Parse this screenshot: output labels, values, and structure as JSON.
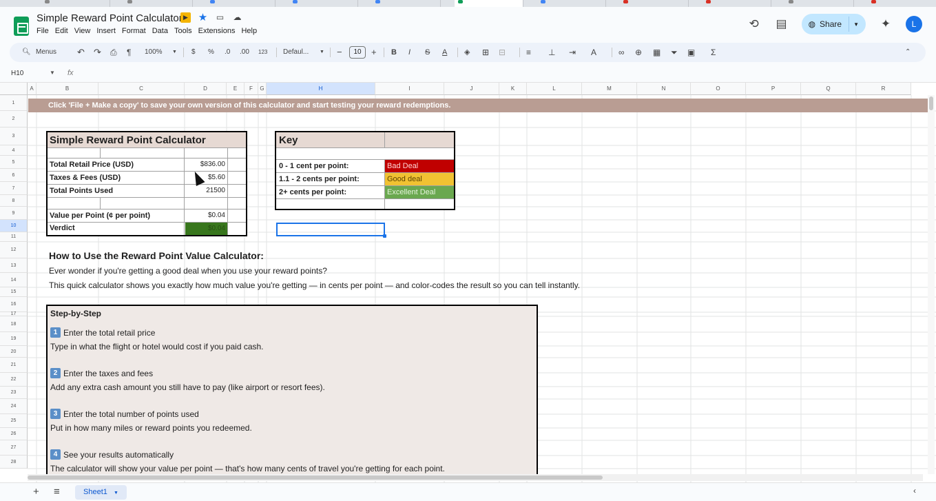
{
  "app": {
    "doc_title": "Simple Reward Point Calculator",
    "menu": [
      "File",
      "Edit",
      "View",
      "Insert",
      "Format",
      "Data",
      "Tools",
      "Extensions",
      "Help"
    ],
    "share_label": "Share",
    "avatar_initial": "L"
  },
  "toolbar": {
    "menus_label": "Menus",
    "zoom": "100%",
    "currency": "$",
    "percent": "%",
    "dec_decrease": ".0",
    "dec_increase": ".00",
    "number_format": "123",
    "font": "Defaul...",
    "font_size": "10",
    "minus": "−",
    "plus": "+"
  },
  "formula_bar": {
    "cell_ref": "H10",
    "fx": "fx"
  },
  "columns": [
    "A",
    "B",
    "C",
    "D",
    "E",
    "F",
    "G",
    "H",
    "I",
    "J",
    "K",
    "L",
    "M",
    "N",
    "O",
    "P",
    "Q",
    "R"
  ],
  "rows": [
    "1",
    "2",
    "3",
    "4",
    "5",
    "6",
    "7",
    "8",
    "9",
    "10",
    "11",
    "12",
    "13",
    "14",
    "15",
    "16",
    "17",
    "18",
    "19",
    "20",
    "21",
    "22",
    "23",
    "24",
    "25",
    "26",
    "27",
    "28"
  ],
  "banner": "Click 'File + Make a copy' to save your own version of this calculator and start testing your reward redemptions.",
  "calculator": {
    "title": "Simple Reward Point Calculator",
    "rows": [
      {
        "label": "Total Retail Price (USD)",
        "value": "$836.00"
      },
      {
        "label": "Taxes & Fees (USD)",
        "value": "$5.60"
      },
      {
        "label": "Total Points Used",
        "value": "21500"
      },
      {
        "label": "Value per Point (¢ per point)",
        "value": "$0.04"
      },
      {
        "label": "Verdict",
        "value": "$0.04"
      }
    ]
  },
  "key": {
    "title": "Key",
    "rows": [
      {
        "label": "0 - 1 cent per point:",
        "value": "Bad Deal",
        "color": "#c00000"
      },
      {
        "label": "1.1 - 2 cents per point:",
        "value": "Good deal",
        "color": "#f1c232"
      },
      {
        "label": "2+ cents per point:",
        "value": "Excellent Deal",
        "color": "#6aa84f"
      }
    ]
  },
  "howto": {
    "title": "How to Use the Reward Point Value Calculator:",
    "line1": "Ever wonder if you're getting a good deal when you use your reward points?",
    "line2": "This quick calculator shows you exactly how much value you're getting — in cents per point — and color-codes the result so you can tell instantly."
  },
  "steps": {
    "heading": "Step-by-Step",
    "items": [
      {
        "num": "1",
        "title": "Enter the total retail price",
        "desc": "Type in what the flight or hotel would cost if you paid cash."
      },
      {
        "num": "2",
        "title": "Enter the taxes and fees",
        "desc": "Add any extra cash amount you still have to pay (like airport or resort fees)."
      },
      {
        "num": "3",
        "title": "Enter the total number of points used",
        "desc": "Put in how many miles or reward points you redeemed."
      },
      {
        "num": "4",
        "title": "See your results automatically",
        "desc": "The calculator will show your value per point — that's how many cents of travel you're getting for each point."
      }
    ]
  },
  "sheets": {
    "active": "Sheet1"
  },
  "colors": {
    "banner": "#b99d93",
    "verdict_fill": "#38761d",
    "selection": "#1a73e8",
    "share_bg": "#c2e7ff"
  }
}
